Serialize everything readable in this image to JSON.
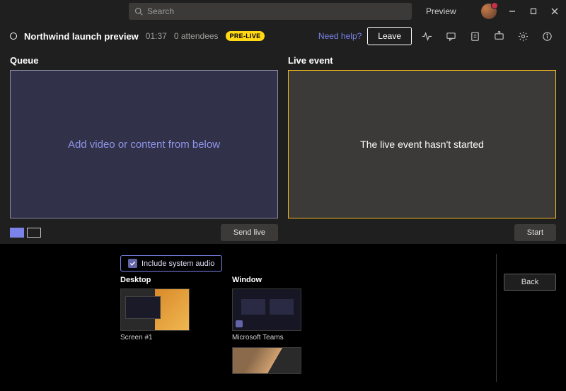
{
  "titlebar": {
    "search_placeholder": "Search",
    "mode_label": "Preview"
  },
  "header": {
    "title": "Northwind launch preview",
    "elapsed": "01:37",
    "attendees": "0 attendees",
    "status_badge": "PRE-LIVE",
    "help": "Need help?",
    "leave": "Leave"
  },
  "panels": {
    "queue_title": "Queue",
    "queue_placeholder": "Add video or content from below",
    "live_title": "Live event",
    "live_placeholder": "The live event hasn't started",
    "send_live": "Send live",
    "start": "Start"
  },
  "share": {
    "include_audio": "Include system audio",
    "desktop_label": "Desktop",
    "window_label": "Window",
    "screen1_label": "Screen #1",
    "teams_label": "Microsoft Teams",
    "back": "Back"
  }
}
